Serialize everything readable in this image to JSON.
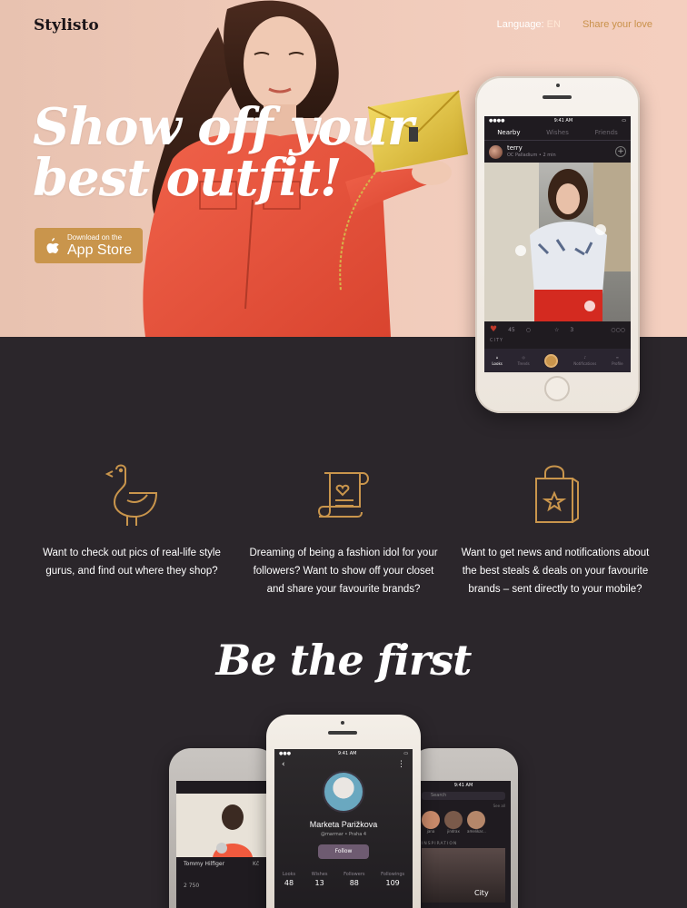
{
  "brand": "Stylisto",
  "nav": {
    "language_label": "Language:",
    "language_value": "EN",
    "share": "Share your love"
  },
  "hero": {
    "headline_line1": "Show off your",
    "headline_line2": "best outfit!",
    "appstore_small": "Download on the",
    "appstore_big": "App Store"
  },
  "hero_phone": {
    "time": "9:41 AM",
    "tabs": [
      "Nearby",
      "Wishes",
      "Friends"
    ],
    "user": {
      "name": "terry",
      "location": "OC Palladium • 2 min"
    },
    "likes": "45",
    "stars": "3",
    "city_label": "CITY",
    "bottom_tabs": [
      "Looks",
      "Trends",
      "",
      "Notifications",
      "Profile"
    ]
  },
  "features": [
    {
      "icon": "bird-icon",
      "text": "Want to check out pics of real-life style gurus, and find out where they shop?"
    },
    {
      "icon": "scroll-heart-icon",
      "text": "Dreaming of being a fashion idol for your followers? Want to show off your closet and share your favourite brands?"
    },
    {
      "icon": "shopping-bag-star-icon",
      "text": "Want to get news and notifications about the best steals & deals on your favourite brands – sent directly to your mobile?"
    }
  ],
  "be_first": "Be the first",
  "profile_phone": {
    "time": "9:41 AM",
    "name": "Marketa Parižkova",
    "handle": "@marmar",
    "city": "Praha 4",
    "follow": "Follow",
    "stats": [
      {
        "label": "Looks",
        "value": "48"
      },
      {
        "label": "Wishes",
        "value": "13"
      },
      {
        "label": "Followers",
        "value": "88"
      },
      {
        "label": "Followings",
        "value": "109"
      }
    ]
  },
  "left_phone": {
    "brand": "Tommy Hilfiger",
    "price": "2 750",
    "currency": "Kč"
  },
  "right_phone": {
    "time": "9:41 AM",
    "search": "Search",
    "see_all": "See all",
    "section": "INSPIRATION",
    "city": "City",
    "avatars": [
      "jana",
      "jindrax",
      "amelikar..."
    ]
  },
  "colors": {
    "accent": "#c9954c",
    "dark_bg": "#2b262b",
    "hero_bg": "#efc9b8"
  }
}
